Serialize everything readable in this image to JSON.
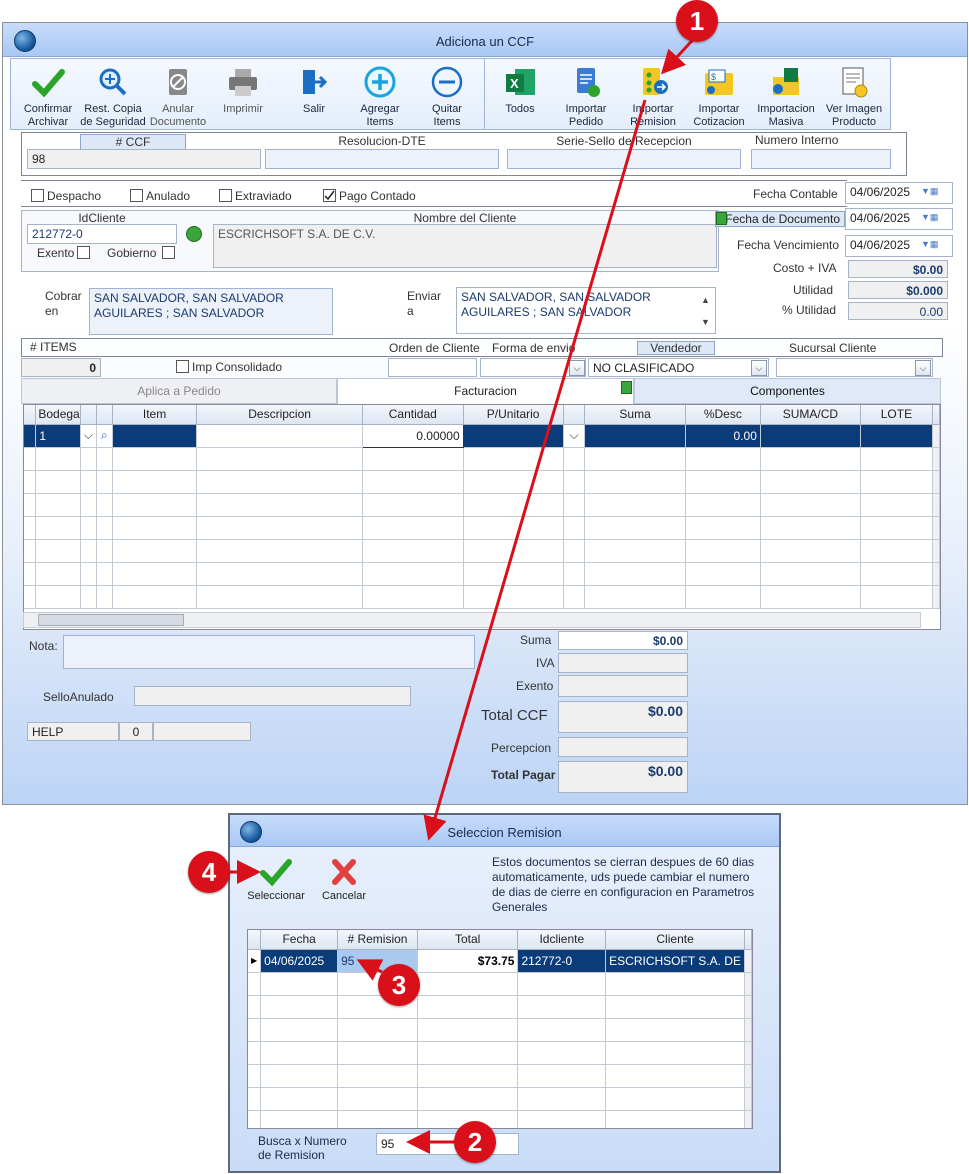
{
  "main": {
    "title": "Adiciona un CCF",
    "toolbar": [
      {
        "label": "Confirmar\nArchivar",
        "icon": "check-icon"
      },
      {
        "label": "Rest. Copia\nde Seguridad",
        "icon": "magnifier-icon"
      },
      {
        "label": "Anular\nDocumento",
        "icon": "cancel-doc-icon"
      },
      {
        "label": "Imprimir",
        "icon": "printer-icon"
      },
      {
        "label": "Salir",
        "icon": "exit-icon"
      },
      {
        "label": "Agregar\nItems",
        "icon": "plus-circle-icon"
      },
      {
        "label": "Quitar\nItems",
        "icon": "minus-circle-icon"
      }
    ],
    "toolbar2": [
      {
        "label": "Todos",
        "icon": "excel-icon"
      },
      {
        "label": "Importar\nPedido",
        "icon": "import-order-icon"
      },
      {
        "label": "Importar\nRemision",
        "icon": "import-remission-icon"
      },
      {
        "label": "Importar\nCotizacion",
        "icon": "import-quote-icon"
      },
      {
        "label": "Importacion\nMasiva",
        "icon": "bulk-import-icon"
      },
      {
        "label": "Ver Imagen\nProducto",
        "icon": "product-image-icon"
      }
    ],
    "header": {
      "ccf_label": "# CCF",
      "ccf_value": "98",
      "resolucion_label": "Resolucion-DTE",
      "serie_label": "Serie-Sello de Recepcion",
      "numero_interno_label": "Numero Interno"
    },
    "checks": {
      "despacho": "Despacho",
      "anulado": "Anulado",
      "extraviado": "Extraviado",
      "pago_contado": "Pago Contado"
    },
    "fechas": {
      "contable_label": "Fecha Contable",
      "contable": "04/06/2025",
      "documento_label": "Fecha de  Documento",
      "documento": "04/06/2025",
      "vencimiento_label": "Fecha Vencimiento",
      "vencimiento": "04/06/2025"
    },
    "cliente": {
      "id_label": "IdCliente",
      "id": "212772-0",
      "nombre_label": "Nombre del Cliente",
      "nombre": "ESCRICHSOFT S.A. DE C.V.",
      "exento": "Exento",
      "gobierno": "Gobierno"
    },
    "costos": {
      "costo_iva_label": "Costo + IVA",
      "costo_iva": "$0.00",
      "utilidad_label": "Utilidad",
      "utilidad": "$0.000",
      "pct_utilidad_label": "% Utilidad",
      "pct_utilidad": "0.00"
    },
    "cobrar": {
      "label": "Cobrar\nen",
      "value": "SAN SALVADOR, SAN SALVADOR\nAGUILARES ; SAN SALVADOR"
    },
    "enviar": {
      "label": "Enviar\na",
      "value": "SAN SALVADOR, SAN SALVADOR\nAGUILARES ; SAN SALVADOR"
    },
    "row3": {
      "items_label": "# ITEMS",
      "items": "0",
      "imp_consolidado": "Imp Consolidado",
      "orden_label": "Orden de Cliente",
      "forma_label": "Forma de envio",
      "vendedor_label": "Vendedor",
      "vendedor": "NO CLASIFICADO",
      "sucursal_label": "Sucursal Cliente"
    },
    "tabs": [
      "Aplica a Pedido",
      "Facturacion",
      "Componentes"
    ],
    "grid": {
      "columns": [
        "Bodega",
        "Item",
        "Descripcion",
        "Cantidad",
        "P/Unitario",
        "Suma",
        "%Desc",
        "SUMA/CD",
        "LOTE"
      ],
      "row": {
        "bodega": "1",
        "cantidad": "0.00000",
        "desc": "0.00"
      }
    },
    "footer": {
      "nota_label": "Nota:",
      "sello_label": "SelloAnulado",
      "help": "HELP",
      "help_num": "0",
      "suma_label": "Suma",
      "suma": "$0.00",
      "iva_label": "IVA",
      "exento_label": "Exento",
      "total_ccf_label": "Total CCF",
      "total_ccf": "$0.00",
      "percepcion_label": "Percepcion",
      "total_pagar_label": "Total Pagar",
      "total_pagar": "$0.00"
    }
  },
  "dialog": {
    "title": "Seleccion Remision",
    "select_label": "Seleccionar",
    "cancel_label": "Cancelar",
    "note": "Estos documentos se cierran despues de 60 dias automaticamente, uds puede cambiar el numero de dias de cierre en configuracion en Parametros Generales",
    "columns": [
      "Fecha",
      "# Remision",
      "Total",
      "Idcliente",
      "Cliente"
    ],
    "row": {
      "fecha": "04/06/2025",
      "remision": "95",
      "total": "$73.75",
      "idcliente": "212772-0",
      "cliente": "ESCRICHSOFT S.A. DE"
    },
    "search_label": "Busca x Numero\nde Remision",
    "search_value": "95"
  },
  "badges": [
    "1",
    "2",
    "3",
    "4"
  ],
  "colors": {
    "annotation": "#d90f1a",
    "selection": "#0b3c7a",
    "titlebar": "#b4cff6"
  }
}
